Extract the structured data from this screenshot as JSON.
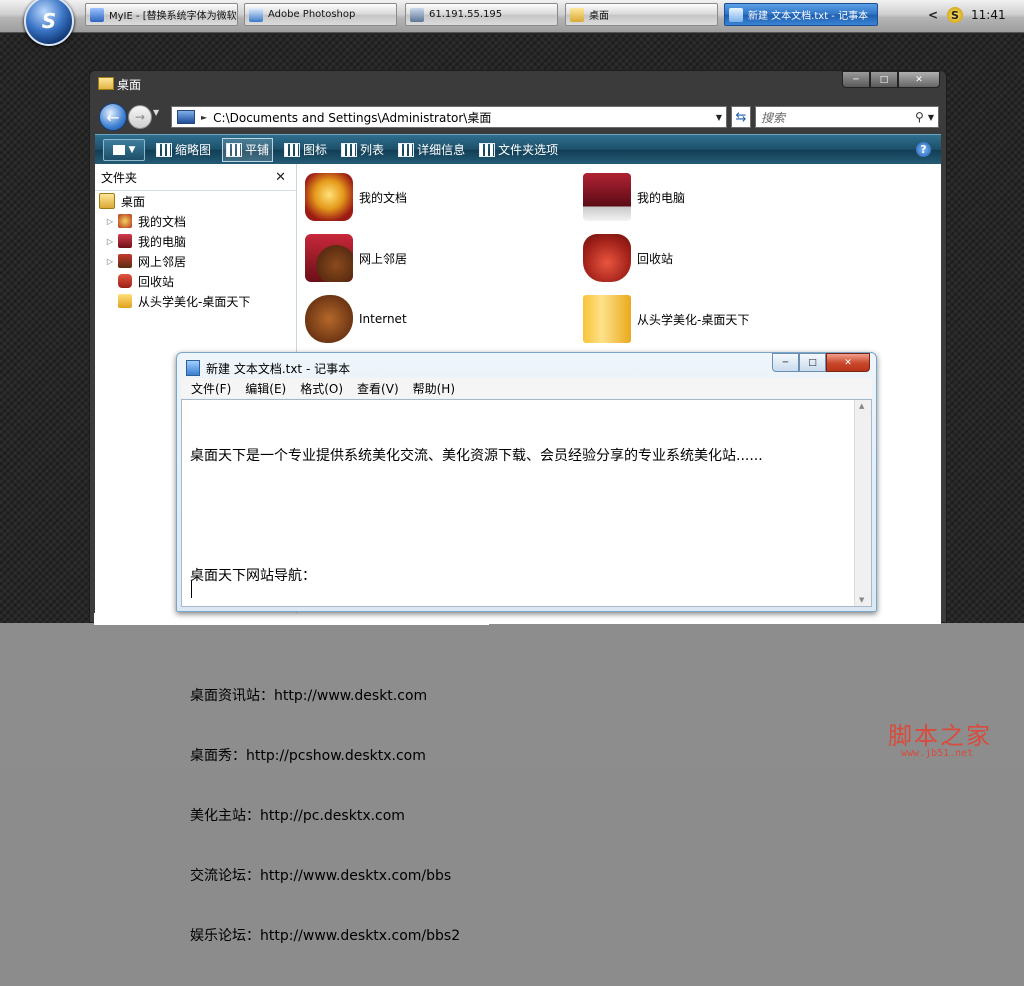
{
  "taskbar": {
    "buttons": [
      {
        "label": "MyIE - [替换系统字体为微软雅..."
      },
      {
        "label": "Adobe Photoshop"
      },
      {
        "label": "61.191.55.195"
      },
      {
        "label": "桌面"
      },
      {
        "label": "新建 文本文档.txt - 记事本"
      }
    ],
    "tray_arrow": "<",
    "clock": "11:41"
  },
  "explorer": {
    "title": "桌面",
    "address": "C:\\Documents and Settings\\Administrator\\桌面",
    "search_placeholder": "搜索",
    "toolbar": [
      "缩略图",
      "平铺",
      "图标",
      "列表",
      "详细信息",
      "文件夹选项"
    ],
    "pane_title": "文件夹",
    "tree": [
      "桌面",
      "我的文档",
      "我的电脑",
      "网上邻居",
      "回收站",
      "从头学美化-桌面天下"
    ],
    "tiles": [
      "我的文档",
      "我的电脑",
      "网上邻居",
      "回收站",
      "Internet",
      "从头学美化-桌面天下"
    ]
  },
  "notepad": {
    "title": "新建 文本文档.txt - 记事本",
    "menu": [
      "文件(F)",
      "编辑(E)",
      "格式(O)",
      "查看(V)",
      "帮助(H)"
    ],
    "lines": [
      "桌面天下是一个专业提供系统美化交流、美化资源下载、会员经验分享的专业系统美化站......",
      "",
      "桌面天下网站导航：",
      "",
      "桌面资讯站：http://www.deskt.com",
      "桌面秀：http://pcshow.desktx.com",
      "美化主站：http://pc.desktx.com",
      "交流论坛：http://www.desktx.com/bbs",
      "娱乐论坛：http://www.desktx.com/bbs2"
    ]
  },
  "watermark": {
    "text": "脚本之家",
    "url": "www.jb51.net"
  }
}
